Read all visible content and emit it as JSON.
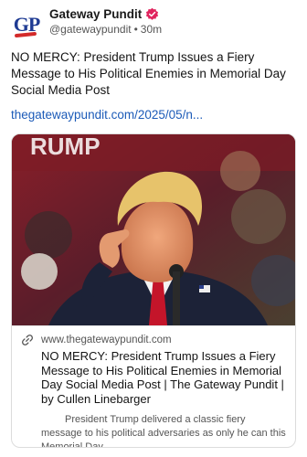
{
  "account": {
    "name": "Gateway Pundit",
    "handle": "@gatewaypundit",
    "time": "30m",
    "avatar_text": "GP",
    "verified_color": "#e0245e"
  },
  "post": {
    "text": "NO MERCY: President Trump Issues a Fiery Message to His Political Enemies in Memorial Day Social Media Post",
    "link": "thegatewaypundit.com/2025/05/n..."
  },
  "card": {
    "image_text": "RUMP",
    "domain": "www.thegatewaypundit.com",
    "title": "NO MERCY: President Trump Issues a Fiery Message to His Political Enemies in Memorial Day Social Media Post | The Gateway Pundit | by Cullen Linebarger",
    "description": "President Trump delivered a classic fiery message to his political adversaries as only he can this Memorial Day.",
    "link_icon": "link-icon"
  },
  "colors": {
    "link": "#1c5bb8",
    "brand_blue": "#1f3b93",
    "brand_red": "#d32a2a"
  }
}
